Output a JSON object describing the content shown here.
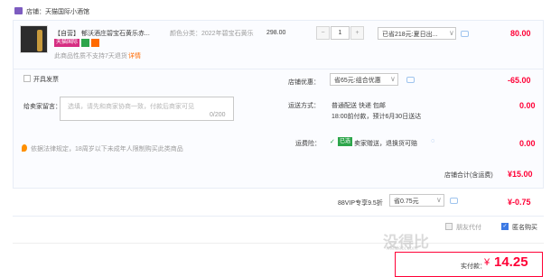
{
  "shop": {
    "label": "店铺：天猫国际小酒馆"
  },
  "item": {
    "title": "【自营】 郁沃酒庄碧宝石黄乐赤...",
    "attr": "颜色分类：2022年碧宝石黄乐",
    "badge": "天猫国际",
    "notice": "此商品性质不支持7天退货",
    "notice_link": "详情",
    "price": "298.00",
    "qty": "1",
    "minus": "−",
    "plus": "+",
    "promo": "已省218元:夏日出...",
    "total": "80.00"
  },
  "invoice": {
    "label": "开具发票"
  },
  "shop_promo": {
    "label": "店铺优惠：",
    "value": "省65元:组合优惠",
    "amount": "-65.00"
  },
  "message": {
    "label": "给卖家留言：",
    "placeholder": "选填，请先和商家协商一致，付款后商家可见",
    "count": "0/200"
  },
  "shipping": {
    "label": "运送方式：",
    "line1": "普通配送 快递 包邮",
    "line2": "18:00前付款，预计6月30日送达",
    "amount": "0.00"
  },
  "legal": {
    "text": "依据法律规定，18周岁以下未成年人限制购买此类商品"
  },
  "insurance": {
    "label": "运费险：",
    "tag": "已选",
    "text": "卖家赠送，退换货可赔",
    "amount": "0.00"
  },
  "shop_total": {
    "label": "店铺合计(含运费)",
    "value": "¥15.00"
  },
  "vip": {
    "label": "88VIP专享9.5折",
    "value": "省0.75元",
    "amount": "¥-0.75"
  },
  "options": {
    "friend_pay": "朋友代付",
    "anonymous": "匿名购买"
  },
  "pay": {
    "label": "实付款：",
    "currency": "¥",
    "amount": "14.25"
  },
  "watermark": {
    "main": "没得比",
    "sub": "Meidebi.com"
  },
  "colors": {
    "accent": "#ff0036",
    "badge": "#d62e82"
  }
}
